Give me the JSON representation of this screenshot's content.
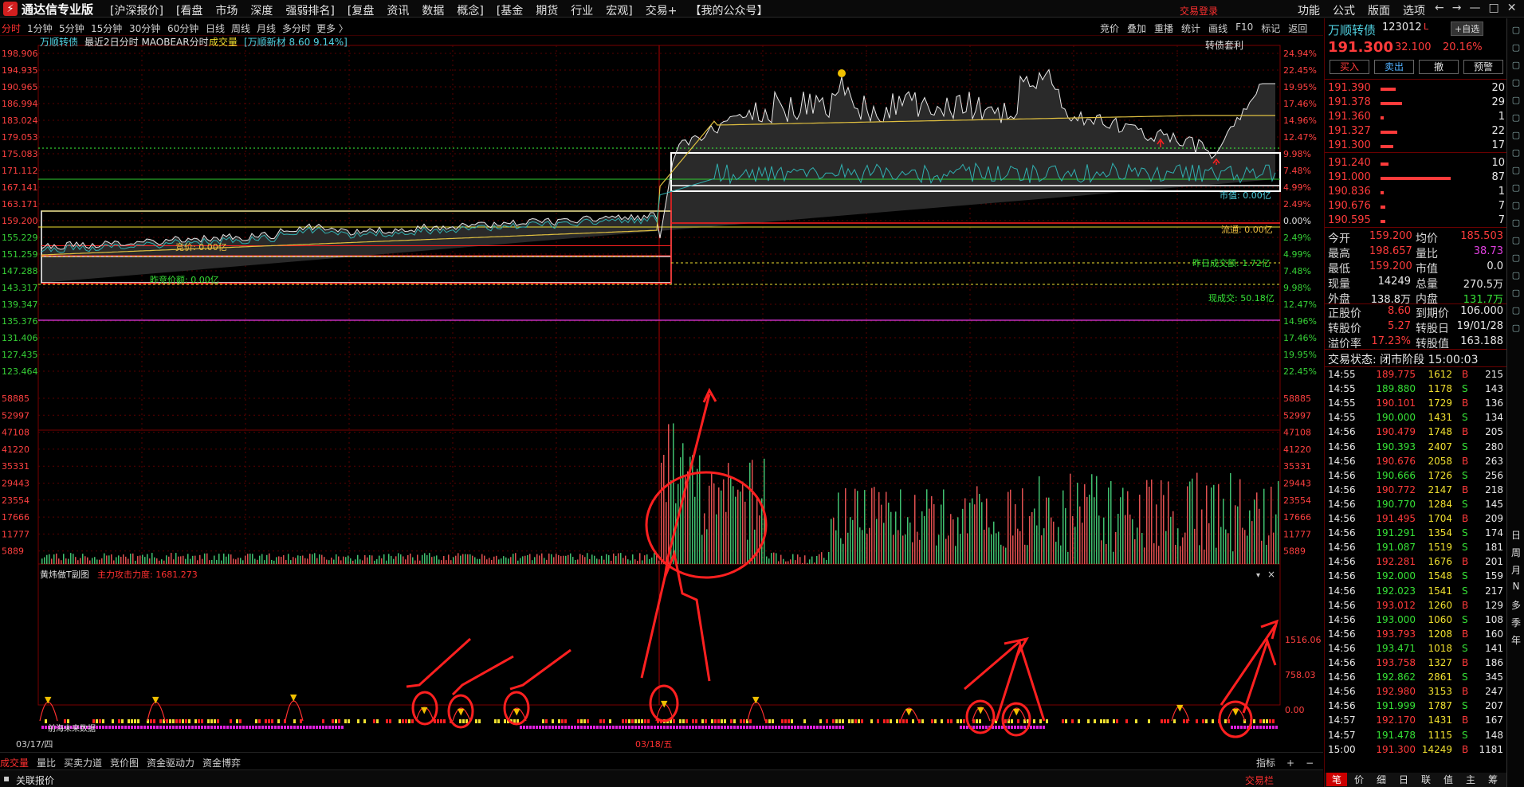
{
  "app": {
    "logo": "通达信专业版",
    "menu": [
      "[沪深报价]",
      "[看盘",
      "市场",
      "深度",
      "强弱排名]",
      "[复盘",
      "资讯",
      "数据",
      "概念]",
      "[基金",
      "期货",
      "行业",
      "宏观]",
      "交易+",
      "【我的公众号】"
    ],
    "login": "交易登录",
    "right_menu": [
      "功能",
      "公式",
      "版面",
      "选项"
    ],
    "win_buttons": [
      "←",
      "→",
      "—",
      "□",
      "✕"
    ]
  },
  "periods": [
    "分时",
    "1分钟",
    "5分钟",
    "15分钟",
    "30分钟",
    "60分钟",
    "日线",
    "周线",
    "月线",
    "多分时",
    "更多 〉"
  ],
  "active_period": "分时",
  "tools": [
    "竞价",
    "叠加",
    "重播",
    "统计",
    "画线",
    "F10",
    "标记",
    "返回"
  ],
  "chart": {
    "info_name": "万顺转债",
    "info_text": "最近2日分时 MAOBEAR分时",
    "info_vol": "成交量",
    "info_tag": "[万顺新材 8.60 9.14%]",
    "top_right": "转债套利",
    "price_labels": [
      "198.906",
      "194.935",
      "190.965",
      "186.994",
      "183.024",
      "179.053",
      "175.083",
      "171.112",
      "167.141",
      "163.171",
      "159.200",
      "155.229",
      "151.259",
      "147.288",
      "143.317",
      "139.347",
      "135.376",
      "131.406",
      "127.435",
      "123.464"
    ],
    "pct_labels": [
      "24.94%",
      "22.45%",
      "19.95%",
      "17.46%",
      "14.96%",
      "12.47%",
      "9.98%",
      "7.48%",
      "4.99%",
      "2.49%",
      "0.00%",
      "2.49%",
      "4.99%",
      "7.48%",
      "9.98%",
      "12.47%",
      "14.96%",
      "17.46%",
      "19.95%",
      "22.45%"
    ],
    "vol_labels": [
      "58885",
      "52997",
      "47108",
      "41220",
      "35331",
      "29443",
      "23554",
      "17666",
      "11777",
      "5889"
    ],
    "sub_labels": [
      "1516.06",
      "758.03",
      "0.00"
    ],
    "sub_title": "黄炜做T副图",
    "sub_value": "主力攻击力度: 1681.273",
    "annotations": {
      "mkt_value": "市值: 0.00亿",
      "float_value": "流通: 0.00亿",
      "prev_amount": "昨日成交额: 1.72亿",
      "cur_amount": "现成交: 50.18亿",
      "bid_price": "竞价: 0.00亿",
      "prev_bid": "昨竞价额: 0.00亿",
      "future": "前海未来数据"
    },
    "dates": [
      "03/17/四",
      "03/18/五"
    ],
    "sub_close": "×"
  },
  "chart_data": {
    "type": "line",
    "series": [
      {
        "name": "price",
        "note": "2-day intraday",
        "x": [
          "03/17",
          "03/18"
        ],
        "values": [
          159.2,
          191.3
        ]
      }
    ],
    "ylim": [
      123.464,
      198.906
    ]
  },
  "bottom_tabs": [
    "成交量",
    "量比",
    "买卖力道",
    "竞价图",
    "资金驱动力",
    "资金博弈"
  ],
  "bottom_right": [
    "指标",
    "+",
    "−"
  ],
  "status": {
    "left": "关联报价",
    "right": "交易栏"
  },
  "quote": {
    "name": "万顺转债",
    "code": "123012",
    "mark": "L",
    "btn_self": "+自选",
    "price": "191.300",
    "change": "32.100",
    "pct": "20.16%",
    "actions": [
      "买入",
      "卖出",
      "撤",
      "预警"
    ],
    "asks": [
      {
        "p": "191.390",
        "v": "20",
        "w": 0.12
      },
      {
        "p": "191.378",
        "v": "29",
        "w": 0.17
      },
      {
        "p": "191.360",
        "v": "1",
        "w": 0.01
      },
      {
        "p": "191.327",
        "v": "22",
        "w": 0.13
      },
      {
        "p": "191.300",
        "v": "17",
        "w": 0.1
      }
    ],
    "bids": [
      {
        "p": "191.240",
        "v": "10",
        "w": 0.06
      },
      {
        "p": "191.000",
        "v": "87",
        "w": 0.55
      },
      {
        "p": "190.836",
        "v": "1",
        "w": 0.01
      },
      {
        "p": "190.676",
        "v": "7",
        "w": 0.04
      },
      {
        "p": "190.595",
        "v": "7",
        "w": 0.04
      }
    ],
    "stats": [
      {
        "a": "今开",
        "av": "159.200",
        "b": "均价",
        "bv": "185.503"
      },
      {
        "a": "最高",
        "av": "198.657",
        "b": "量比",
        "bv": "38.73"
      },
      {
        "a": "最低",
        "av": "159.200",
        "b": "市值",
        "bv": "0.0"
      },
      {
        "a": "现量",
        "av": "14249",
        "b": "总量",
        "bv": "270.5万"
      },
      {
        "a": "外盘",
        "av": "138.8万",
        "b": "内盘",
        "bv": "131.7万"
      }
    ],
    "bond": [
      {
        "a": "正股价",
        "av": "8.60",
        "b": "到期价",
        "bv": "106.000"
      },
      {
        "a": "转股价",
        "av": "5.27",
        "b": "转股日",
        "bv": "19/01/28"
      },
      {
        "a": "溢价率",
        "av": "17.23%",
        "b": "转股值",
        "bv": "163.188"
      }
    ],
    "trade_status": "交易状态: 闭市阶段 15:00:03",
    "ticks": [
      [
        "14:55",
        "189.775",
        "1612",
        "B",
        "215"
      ],
      [
        "14:55",
        "189.880",
        "1178",
        "S",
        "143"
      ],
      [
        "14:55",
        "190.101",
        "1729",
        "B",
        "136"
      ],
      [
        "14:55",
        "190.000",
        "1431",
        "S",
        "134"
      ],
      [
        "14:56",
        "190.479",
        "1748",
        "B",
        "205"
      ],
      [
        "14:56",
        "190.393",
        "2407",
        "S",
        "280"
      ],
      [
        "14:56",
        "190.676",
        "2058",
        "B",
        "263"
      ],
      [
        "14:56",
        "190.666",
        "1726",
        "S",
        "256"
      ],
      [
        "14:56",
        "190.772",
        "2147",
        "B",
        "218"
      ],
      [
        "14:56",
        "190.770",
        "1284",
        "S",
        "145"
      ],
      [
        "14:56",
        "191.495",
        "1704",
        "B",
        "209"
      ],
      [
        "14:56",
        "191.291",
        "1354",
        "S",
        "174"
      ],
      [
        "14:56",
        "191.087",
        "1519",
        "S",
        "181"
      ],
      [
        "14:56",
        "192.281",
        "1676",
        "B",
        "201"
      ],
      [
        "14:56",
        "192.000",
        "1548",
        "S",
        "159"
      ],
      [
        "14:56",
        "192.023",
        "1541",
        "S",
        "217"
      ],
      [
        "14:56",
        "193.012",
        "1260",
        "B",
        "129"
      ],
      [
        "14:56",
        "193.000",
        "1060",
        "S",
        "108"
      ],
      [
        "14:56",
        "193.793",
        "1208",
        "B",
        "160"
      ],
      [
        "14:56",
        "193.471",
        "1018",
        "S",
        "141"
      ],
      [
        "14:56",
        "193.758",
        "1327",
        "B",
        "186"
      ],
      [
        "14:56",
        "192.862",
        "2861",
        "S",
        "345"
      ],
      [
        "14:56",
        "192.980",
        "3153",
        "B",
        "247"
      ],
      [
        "14:56",
        "191.999",
        "1787",
        "S",
        "207"
      ],
      [
        "14:57",
        "192.170",
        "1431",
        "B",
        "167"
      ],
      [
        "14:57",
        "191.478",
        "1115",
        "S",
        "148"
      ],
      [
        "15:00",
        "191.300",
        "14249",
        "B",
        "1181"
      ]
    ],
    "tabs": [
      "笔",
      "价",
      "细",
      "日",
      "联",
      "值",
      "主",
      "筹"
    ]
  },
  "sidebar": [
    "日",
    "周",
    "月",
    "N",
    "多",
    "季",
    "年"
  ]
}
